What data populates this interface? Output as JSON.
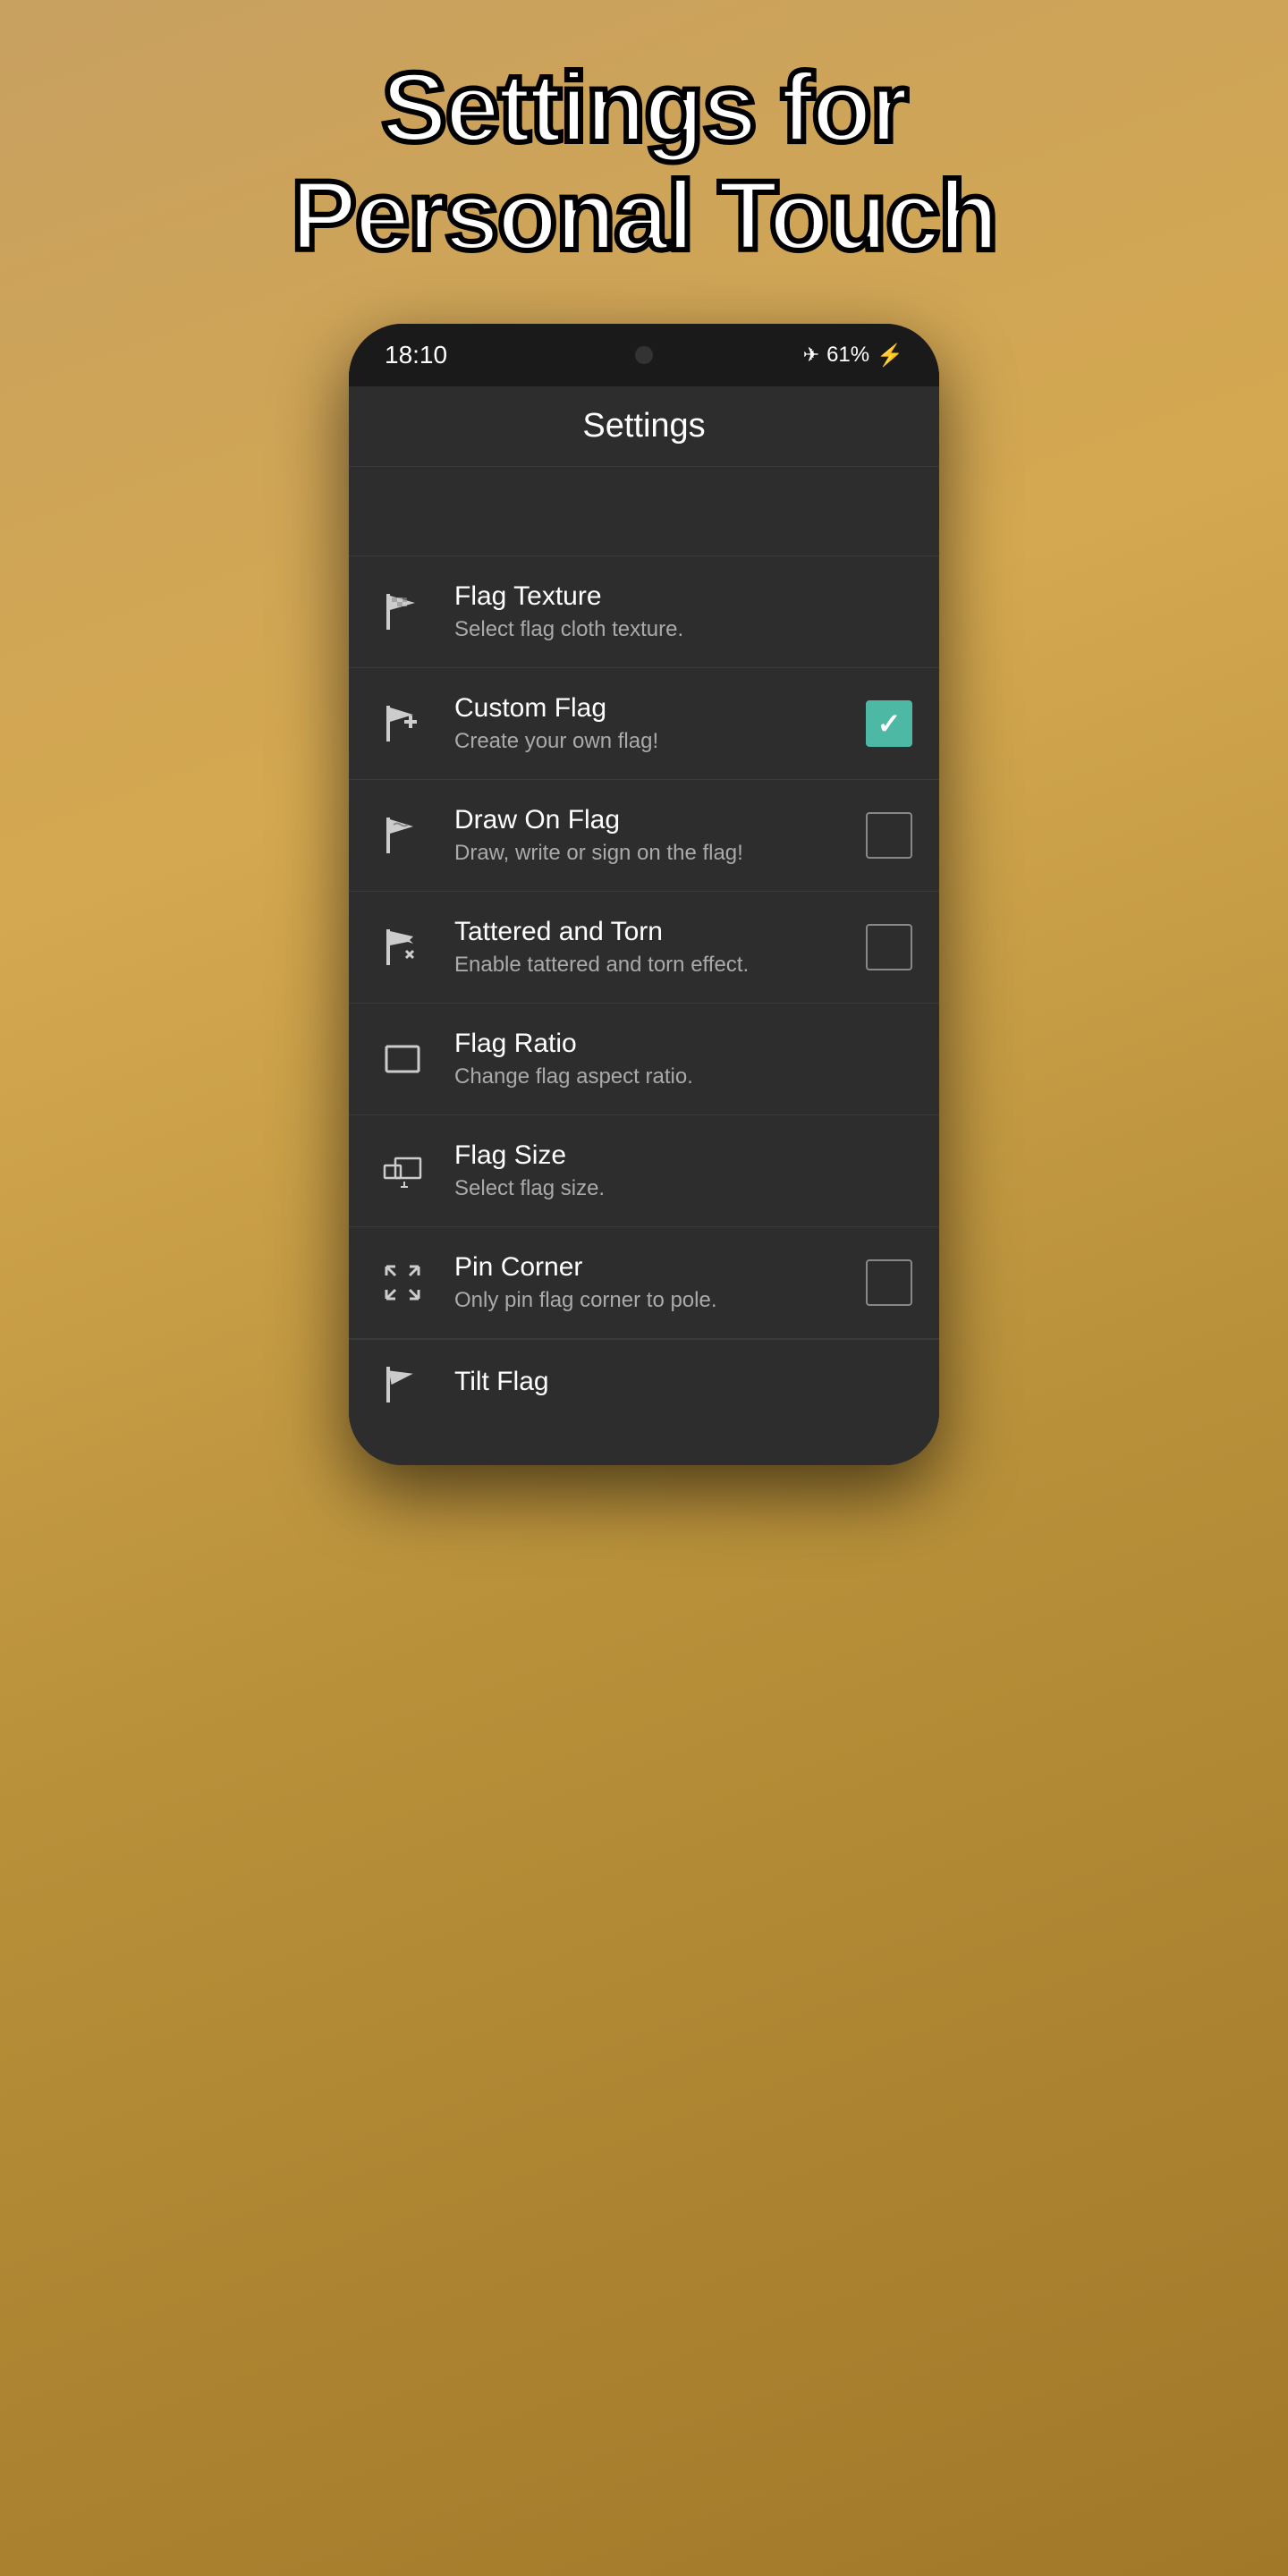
{
  "page": {
    "title_line1": "Settings for",
    "title_line2": "Personal Touch"
  },
  "status_bar": {
    "time": "18:10",
    "battery": "61%",
    "airplane_mode": true
  },
  "app_bar": {
    "title": "Settings"
  },
  "settings_items": [
    {
      "id": "flag-texture",
      "title": "Flag Texture",
      "subtitle": "Select flag cloth texture.",
      "icon": "flag-texture-icon",
      "has_checkbox": false
    },
    {
      "id": "custom-flag",
      "title": "Custom Flag",
      "subtitle": "Create your own flag!",
      "icon": "custom-flag-icon",
      "has_checkbox": true,
      "checked": true
    },
    {
      "id": "draw-on-flag",
      "title": "Draw On Flag",
      "subtitle": "Draw, write or sign on the flag!",
      "icon": "draw-flag-icon",
      "has_checkbox": true,
      "checked": false
    },
    {
      "id": "tattered-torn",
      "title": "Tattered and Torn",
      "subtitle": "Enable tattered and torn effect.",
      "icon": "tattered-flag-icon",
      "has_checkbox": true,
      "checked": false
    },
    {
      "id": "flag-ratio",
      "title": "Flag Ratio",
      "subtitle": "Change flag aspect ratio.",
      "icon": "flag-ratio-icon",
      "has_checkbox": false
    },
    {
      "id": "flag-size",
      "title": "Flag Size",
      "subtitle": "Select flag size.",
      "icon": "flag-size-icon",
      "has_checkbox": false
    },
    {
      "id": "pin-corner",
      "title": "Pin Corner",
      "subtitle": "Only pin flag corner to pole.",
      "icon": "pin-corner-icon",
      "has_checkbox": true,
      "checked": false
    },
    {
      "id": "tilt-flag",
      "title": "Tilt Flag",
      "subtitle": "",
      "icon": "tilt-flag-icon",
      "has_checkbox": false,
      "partial": true
    }
  ]
}
